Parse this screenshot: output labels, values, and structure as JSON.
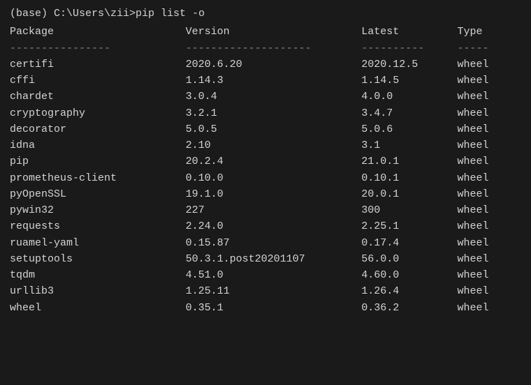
{
  "terminal": {
    "prompt": "(base) C:\\Users\\zii>pip list -o",
    "headers": {
      "package": "Package",
      "version": "Version",
      "latest": "Latest",
      "type": "Type"
    },
    "separators": {
      "package": "----------------",
      "version": "--------------------",
      "latest": "----------",
      "type": "-----"
    },
    "rows": [
      {
        "package": "certifi",
        "version": "2020.6.20",
        "latest": "2020.12.5",
        "type": "wheel"
      },
      {
        "package": "cffi",
        "version": "1.14.3",
        "latest": "1.14.5",
        "type": "wheel"
      },
      {
        "package": "chardet",
        "version": "3.0.4",
        "latest": "4.0.0",
        "type": "wheel"
      },
      {
        "package": "cryptography",
        "version": "3.2.1",
        "latest": "3.4.7",
        "type": "wheel"
      },
      {
        "package": "decorator",
        "version": "5.0.5",
        "latest": "5.0.6",
        "type": "wheel"
      },
      {
        "package": "idna",
        "version": "2.10",
        "latest": "3.1",
        "type": "wheel"
      },
      {
        "package": "pip",
        "version": "20.2.4",
        "latest": "21.0.1",
        "type": "wheel"
      },
      {
        "package": "prometheus-client",
        "version": "0.10.0",
        "latest": "0.10.1",
        "type": "wheel"
      },
      {
        "package": "pyOpenSSL",
        "version": "19.1.0",
        "latest": "20.0.1",
        "type": "wheel"
      },
      {
        "package": "pywin32",
        "version": "227",
        "latest": "300",
        "type": "wheel"
      },
      {
        "package": "requests",
        "version": "2.24.0",
        "latest": "2.25.1",
        "type": "wheel"
      },
      {
        "package": "ruamel-yaml",
        "version": "0.15.87",
        "latest": "0.17.4",
        "type": "wheel"
      },
      {
        "package": "setuptools",
        "version": "50.3.1.post20201107",
        "latest": "56.0.0",
        "type": "wheel"
      },
      {
        "package": "tqdm",
        "version": "4.51.0",
        "latest": "4.60.0",
        "type": "wheel"
      },
      {
        "package": "urllib3",
        "version": "1.25.11",
        "latest": "1.26.4",
        "type": "wheel"
      },
      {
        "package": "wheel",
        "version": "0.35.1",
        "latest": "0.36.2",
        "type": "wheel"
      }
    ]
  }
}
